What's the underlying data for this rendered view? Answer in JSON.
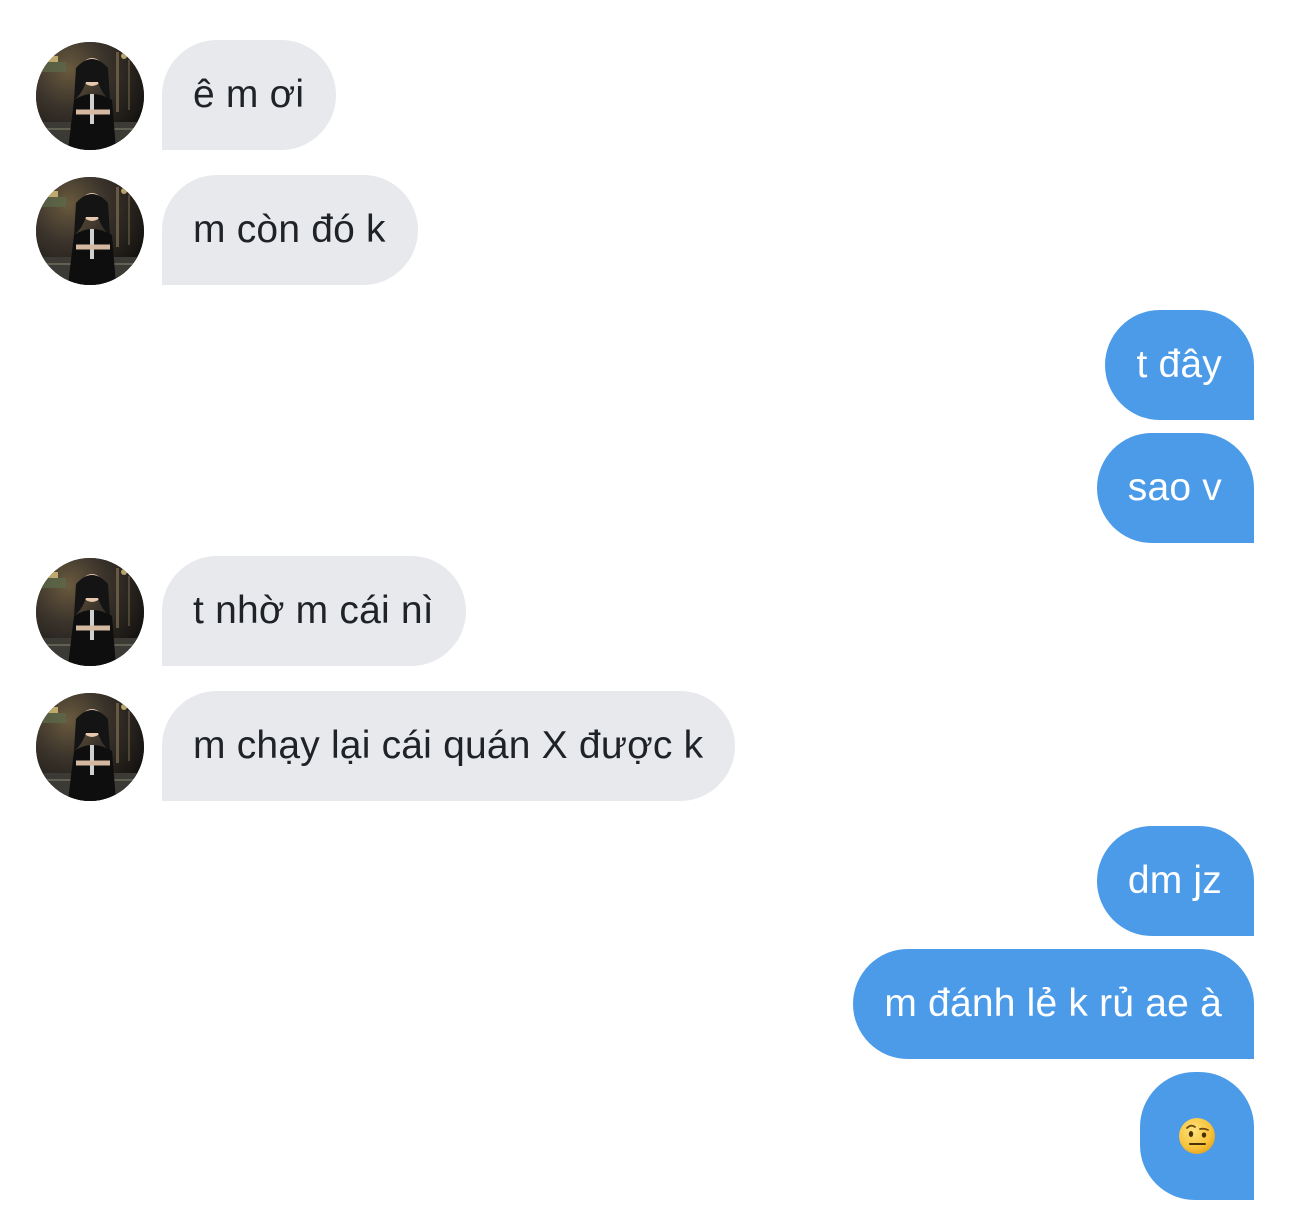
{
  "conversation": {
    "messages": [
      {
        "sender": "contact",
        "text": "ê m ơi"
      },
      {
        "sender": "contact",
        "text": "m còn đó k"
      },
      {
        "sender": "me",
        "text": "t đây"
      },
      {
        "sender": "me",
        "text": "sao v"
      },
      {
        "sender": "contact",
        "text": "t nhờ m cái nì"
      },
      {
        "sender": "contact",
        "text": "m chạy lại cái quán X được k"
      },
      {
        "sender": "me",
        "text": "dm jz"
      },
      {
        "sender": "me",
        "text": "m đánh lẻ k rủ ae à"
      },
      {
        "sender": "me",
        "emoji": "face-with-raised-eyebrow"
      }
    ]
  },
  "colors": {
    "incoming_bubble": "#e7e9ed",
    "outgoing_bubble": "#4c9be9",
    "incoming_text": "#1f2328",
    "outgoing_text": "#ffffff"
  }
}
